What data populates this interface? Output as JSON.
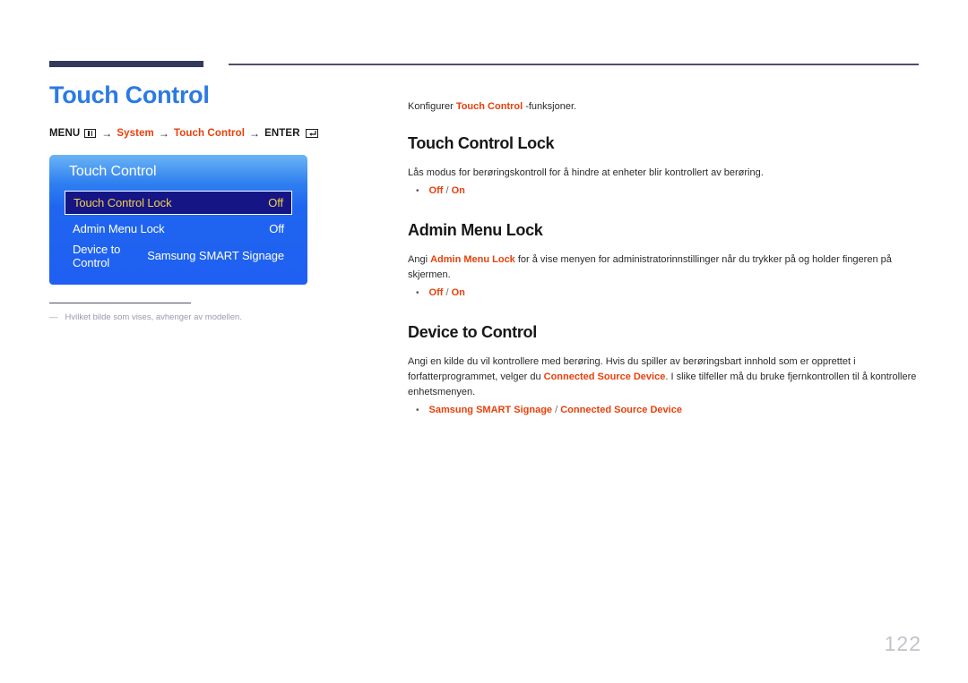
{
  "page": {
    "number": "122"
  },
  "left": {
    "title": "Touch Control",
    "menu_path": {
      "menu_label": "MENU",
      "menu_icon": "menu-icon",
      "arrow": "→",
      "system": "System",
      "touch_control": "Touch Control",
      "enter_label": "ENTER",
      "enter_icon": "enter-icon"
    },
    "osd": {
      "title": "Touch Control",
      "rows": [
        {
          "label": "Touch Control Lock",
          "value": "Off",
          "selected": true
        },
        {
          "label": "Admin Menu Lock",
          "value": "Off",
          "selected": false
        },
        {
          "label": "Device to Control",
          "value": "Samsung SMART Signage",
          "selected": false
        }
      ],
      "colors": {
        "panel_top": "#6ab4f5",
        "panel_bottom": "#1f5ff2",
        "selected_bg": "#151586",
        "selected_text": "#f3cf49"
      }
    },
    "footnote": {
      "dash": "―",
      "text": "Hvilket bilde som vises, avhenger av modellen."
    }
  },
  "right": {
    "intro": {
      "before": "Konfigurer ",
      "emphasis": "Touch Control",
      "after": " -funksjoner."
    },
    "sections": [
      {
        "heading": "Touch Control Lock",
        "body_parts": [
          {
            "text": "Lås modus for berøringskontroll for å hindre at enheter blir kontrollert av berøring.",
            "emphasis": false
          }
        ],
        "bullet": {
          "first": "Off",
          "sep": " / ",
          "second": "On"
        }
      },
      {
        "heading": "Admin Menu Lock",
        "body_parts": [
          {
            "text": "Angi ",
            "emphasis": false
          },
          {
            "text": "Admin Menu Lock",
            "emphasis": true
          },
          {
            "text": " for å vise menyen for administratorinnstillinger når du trykker på og holder fingeren på skjermen.",
            "emphasis": false
          }
        ],
        "bullet": {
          "first": "Off",
          "sep": " / ",
          "second": "On"
        }
      },
      {
        "heading": "Device to Control",
        "body_parts": [
          {
            "text": "Angi en kilde du vil kontrollere med berøring. Hvis du spiller av berøringsbart innhold som er opprettet i forfatterprogrammet, velger du ",
            "emphasis": false
          },
          {
            "text": "Connected Source Device",
            "emphasis": true
          },
          {
            "text": ". I slike tilfeller må du bruke fjernkontrollen til å kontrollere enhetsmenyen.",
            "emphasis": false
          }
        ],
        "bullet": {
          "first": "Samsung SMART Signage",
          "sep": " / ",
          "second": "Connected Source Device"
        }
      }
    ]
  },
  "colors": {
    "title_blue": "#2b7ae4",
    "accent_red": "#e8400c",
    "rule_navy": "#323a5e"
  }
}
